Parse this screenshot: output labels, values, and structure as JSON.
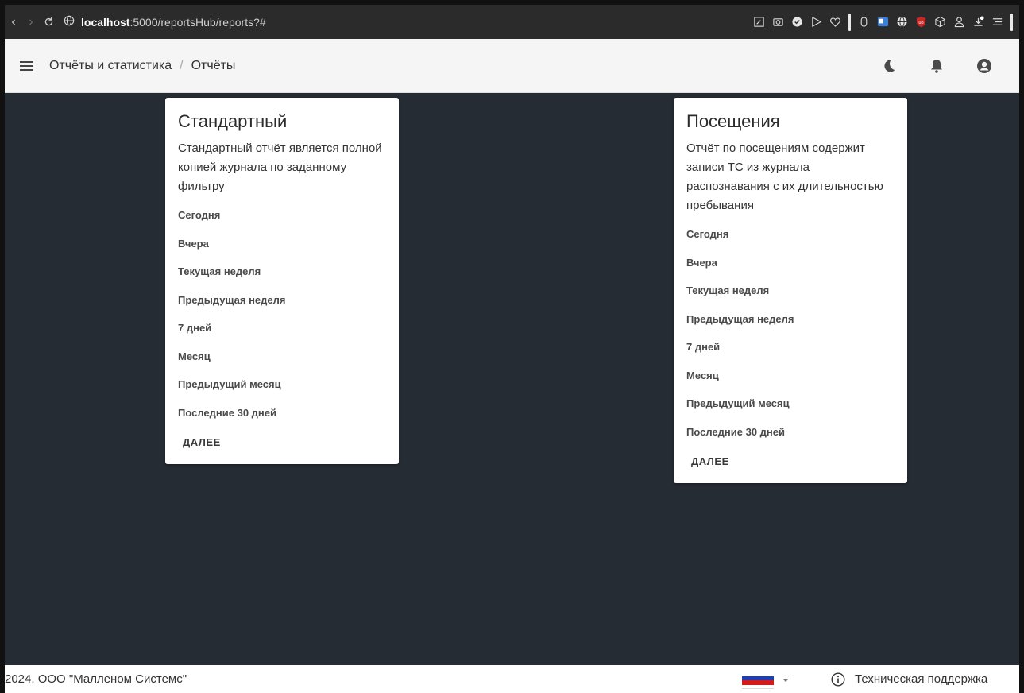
{
  "browser": {
    "url_host": "localhost",
    "url_path": ":5000/reportsHub/reports?#",
    "extensions": [
      "edit-icon",
      "camera-icon",
      "shield-icon",
      "send-icon",
      "heart-icon",
      "mouse-icon",
      "translate-icon",
      "globe-icon",
      "ublock-icon",
      "cube-icon",
      "person-icon",
      "download-icon",
      "list-icon"
    ]
  },
  "appbar": {
    "breadcrumb_root": "Отчёты и статистика",
    "breadcrumb_separator": "/",
    "breadcrumb_current": "Отчёты",
    "actions": [
      "dark-mode-icon",
      "notifications-icon",
      "account-icon"
    ]
  },
  "cards": [
    {
      "title": "Стандартный",
      "description": "Стандартный отчёт является полной копией журнала по заданному фильтру",
      "periods": [
        "Сегодня",
        "Вчера",
        "Текущая неделя",
        "Предыдущая неделя",
        "7 дней",
        "Месяц",
        "Предыдущий месяц",
        "Последние 30 дней"
      ],
      "next_label": "ДАЛЕЕ"
    },
    {
      "title": "Посещения",
      "description": "Отчёт по посещениям содержит записи ТС из журнала распознавания с их длительностью пребывания",
      "periods": [
        "Сегодня",
        "Вчера",
        "Текущая неделя",
        "Предыдущая неделя",
        "7 дней",
        "Месяц",
        "Предыдущий месяц",
        "Последние 30 дней"
      ],
      "next_label": "ДАЛЕЕ"
    }
  ],
  "footer": {
    "copyright": "2024, ООО \"Малленом Системс\"",
    "language": "ru-flag",
    "support_label": "Техническая поддержка"
  },
  "colors": {
    "main_bg": "#262c33",
    "appbar_bg": "#f5f5f5",
    "card_bg": "#ffffff"
  }
}
